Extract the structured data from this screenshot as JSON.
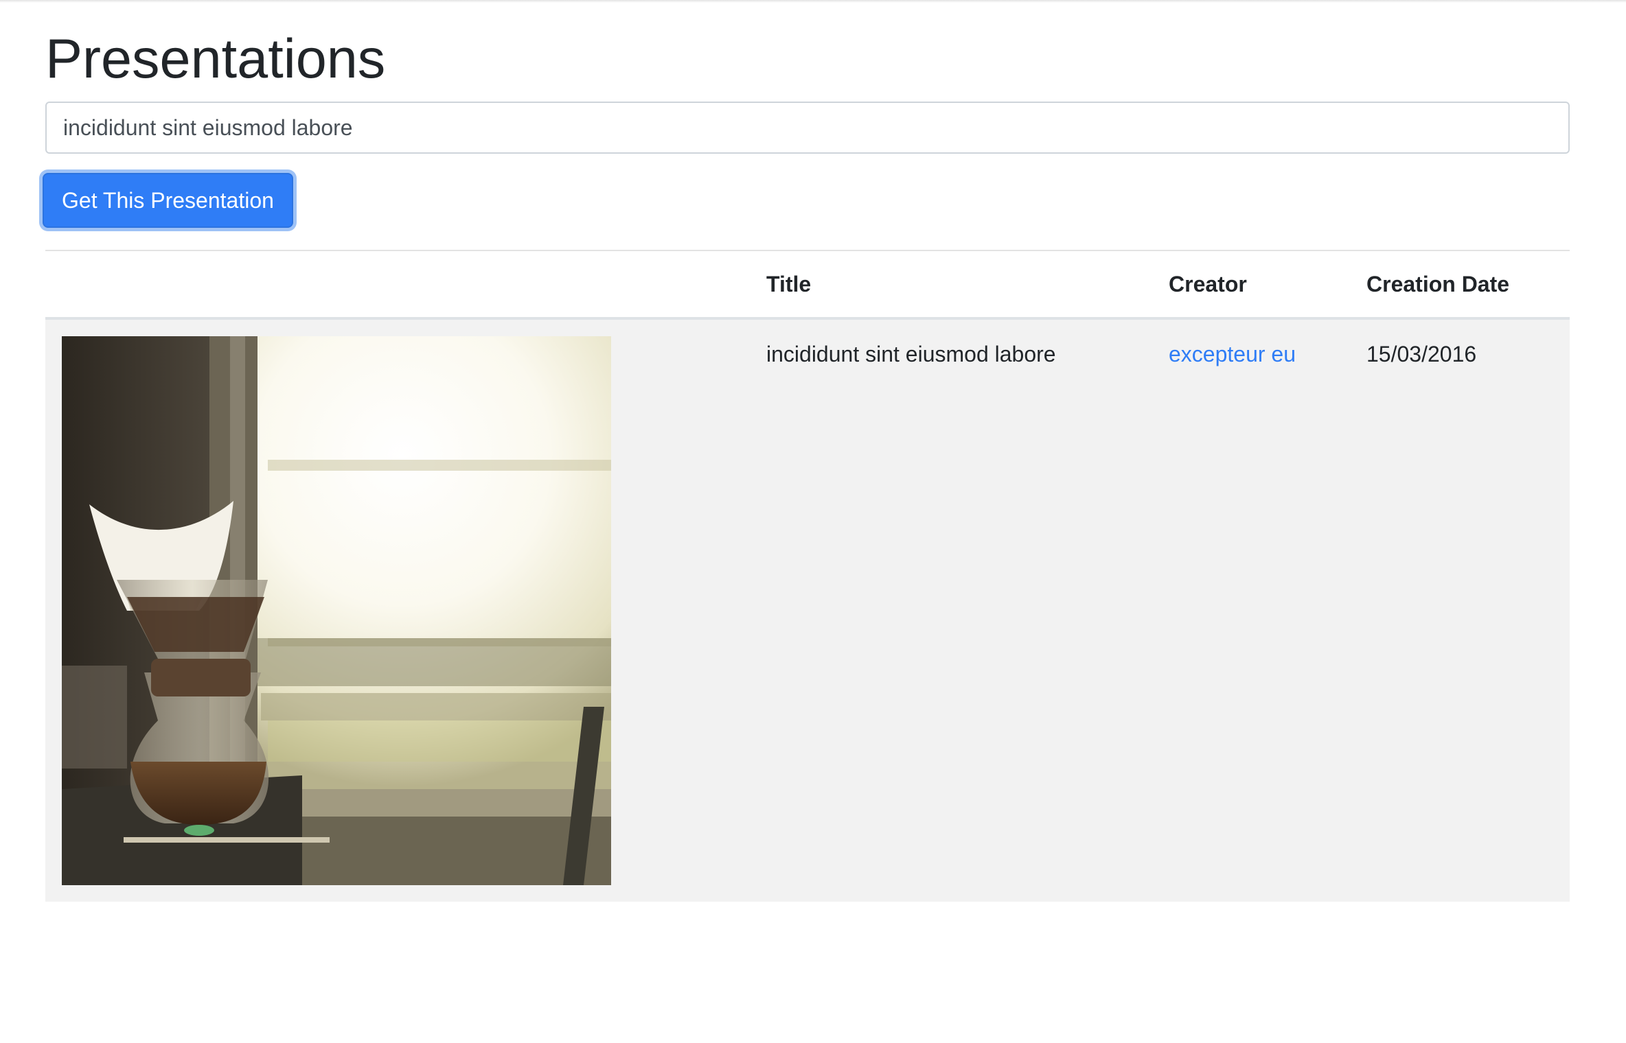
{
  "page": {
    "title": "Presentations"
  },
  "search": {
    "value": "incididunt sint eiusmod labore"
  },
  "actions": {
    "get_button_label": "Get This Presentation"
  },
  "table": {
    "columns": [
      "",
      "Title",
      "Creator",
      "Creation Date"
    ],
    "rows": [
      {
        "thumbnail_icon": "coffee-pour-over-photo",
        "title": "incididunt sint eiusmod labore",
        "creator": "excepteur eu",
        "creation_date": "15/03/2016"
      }
    ]
  },
  "colors": {
    "primary": "#2f7df6",
    "row_background": "#f2f2f2",
    "text": "#212529"
  }
}
